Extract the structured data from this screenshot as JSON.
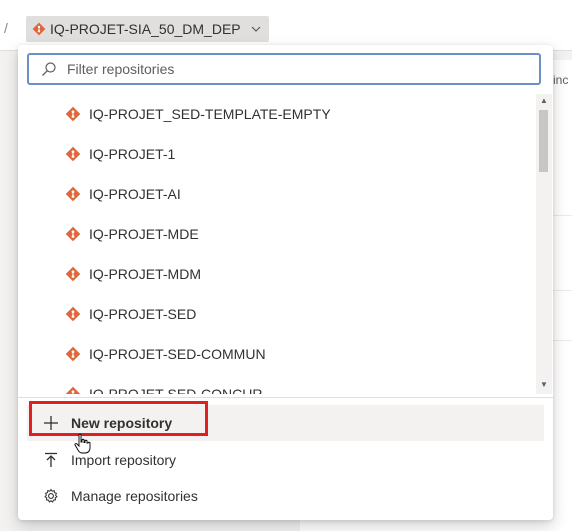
{
  "breadcrumb": {
    "separator": "/",
    "current_repo": "IQ-PROJET-SIA_50_DM_DEP"
  },
  "background": {
    "partial_text": "inc"
  },
  "dropdown": {
    "filter_placeholder": "Filter repositories",
    "repositories": [
      "IQ-PROJET_SED-TEMPLATE-EMPTY",
      "IQ-PROJET-1",
      "IQ-PROJET-AI",
      "IQ-PROJET-MDE",
      "IQ-PROJET-MDM",
      "IQ-PROJET-SED",
      "IQ-PROJET-SED-COMMUN",
      "IQ-PROJET-SED-CONCUR"
    ],
    "actions": {
      "new": "New repository",
      "import": "Import repository",
      "manage": "Manage repositories"
    }
  },
  "colors": {
    "git_icon": "#e0653a",
    "highlight": "#e02020",
    "focus_border": "#6b8fc7"
  }
}
